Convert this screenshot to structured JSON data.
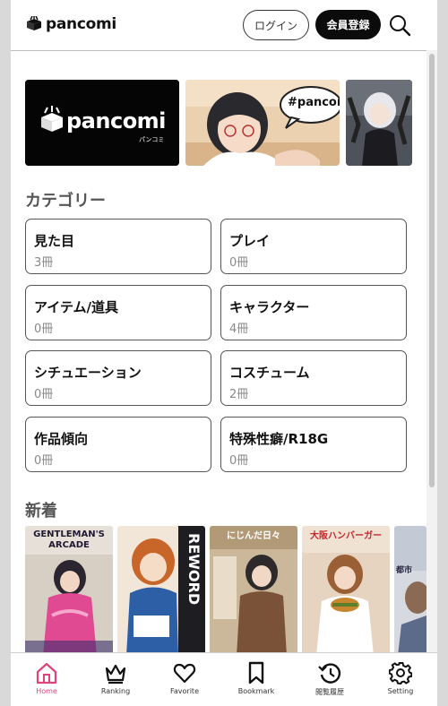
{
  "header": {
    "logo_text": "pancomi",
    "login_label": "ログイン",
    "register_label": "会員登録"
  },
  "banners": [
    {
      "logo_text": "pancomi",
      "logo_sub": "パンコミ"
    },
    {
      "bubble_text": "#pancor"
    },
    {}
  ],
  "categories": {
    "title": "カテゴリー",
    "items": [
      {
        "name": "見た目",
        "count": "3冊"
      },
      {
        "name": "プレイ",
        "count": "0冊"
      },
      {
        "name": "アイテム/道具",
        "count": "0冊"
      },
      {
        "name": "キャラクター",
        "count": "4冊"
      },
      {
        "name": "シチュエーション",
        "count": "0冊"
      },
      {
        "name": "コスチューム",
        "count": "2冊"
      },
      {
        "name": "作品傾向",
        "count": "0冊"
      },
      {
        "name": "特殊性癖/R18G",
        "count": "0冊"
      }
    ]
  },
  "new_arrivals": {
    "title": "新着",
    "covers": [
      {
        "headline": "GENTLEMAN'S ARCADE"
      },
      {
        "headline": "REWORD"
      },
      {
        "headline": "にじんだ日々"
      },
      {
        "headline": "大阪ハンバーガー"
      },
      {
        "headline": "都市"
      }
    ]
  },
  "bottom_nav": {
    "active": "home",
    "active_color": "#e0447a",
    "items": [
      {
        "id": "home",
        "label": "Home",
        "icon": "home-icon"
      },
      {
        "id": "ranking",
        "label": "Ranking",
        "icon": "crown-icon"
      },
      {
        "id": "favorite",
        "label": "Favorite",
        "icon": "heart-icon"
      },
      {
        "id": "bookmark",
        "label": "Bookmark",
        "icon": "bookmark-icon"
      },
      {
        "id": "history",
        "label": "閲覧履歴",
        "icon": "history-icon"
      },
      {
        "id": "setting",
        "label": "Setting",
        "icon": "gear-icon"
      }
    ]
  }
}
